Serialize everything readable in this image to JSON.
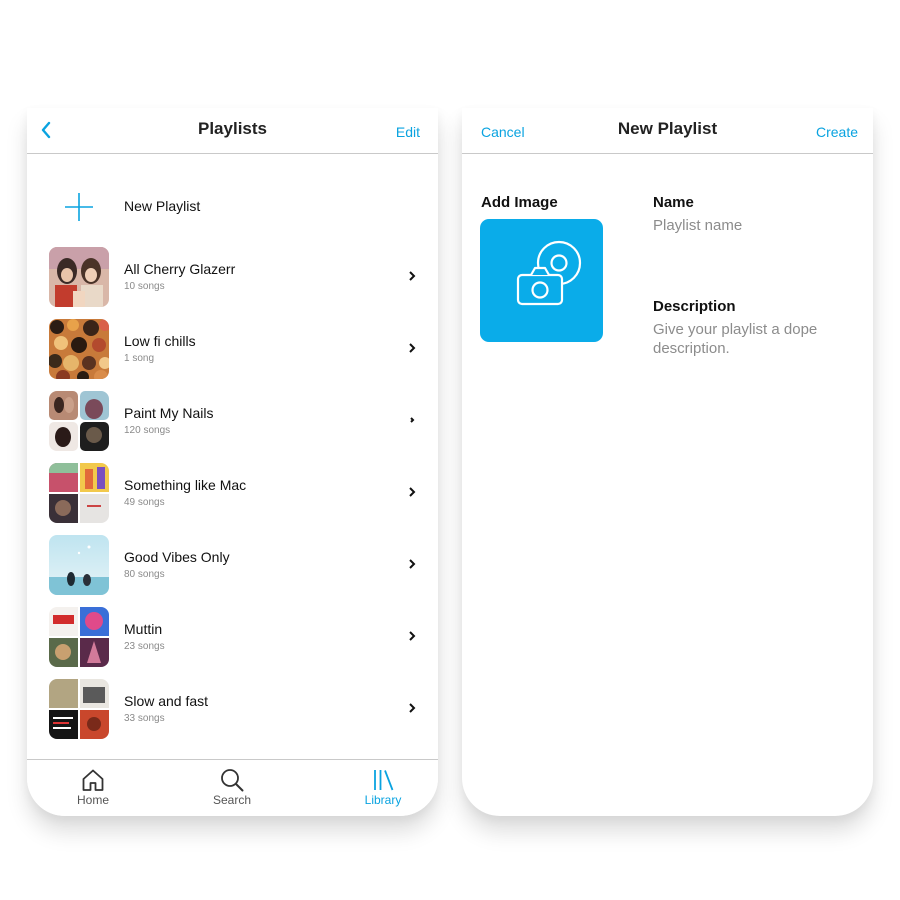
{
  "playlists_screen": {
    "title": "Playlists",
    "edit_label": "Edit",
    "new_playlist_label": "New Playlist",
    "items": [
      {
        "name": "All Cherry Glazerr",
        "count": "10 songs"
      },
      {
        "name": "Low fi chills",
        "count": "1 song"
      },
      {
        "name": "Paint My Nails",
        "count": "120 songs"
      },
      {
        "name": "Something like Mac",
        "count": "49 songs"
      },
      {
        "name": "Good Vibes Only",
        "count": "80 songs"
      },
      {
        "name": "Muttin",
        "count": "23 songs"
      },
      {
        "name": "Slow and fast",
        "count": "33 songs"
      }
    ],
    "tabs": [
      {
        "label": "Home",
        "icon": "home-icon"
      },
      {
        "label": "Search",
        "icon": "search-icon"
      },
      {
        "label": "Library",
        "icon": "library-icon",
        "active": true
      }
    ]
  },
  "new_playlist_screen": {
    "cancel_label": "Cancel",
    "title": "New Playlist",
    "create_label": "Create",
    "add_image_label": "Add Image",
    "add_image_icon": "camera-disc-icon",
    "name_label": "Name",
    "name_placeholder": "Playlist name",
    "description_label": "Description",
    "description_placeholder": "Give your playlist a dope description."
  },
  "colors": {
    "accent": "#0aa3e0",
    "image_tile": "#0aace9",
    "divider": "#c9c9c9"
  }
}
